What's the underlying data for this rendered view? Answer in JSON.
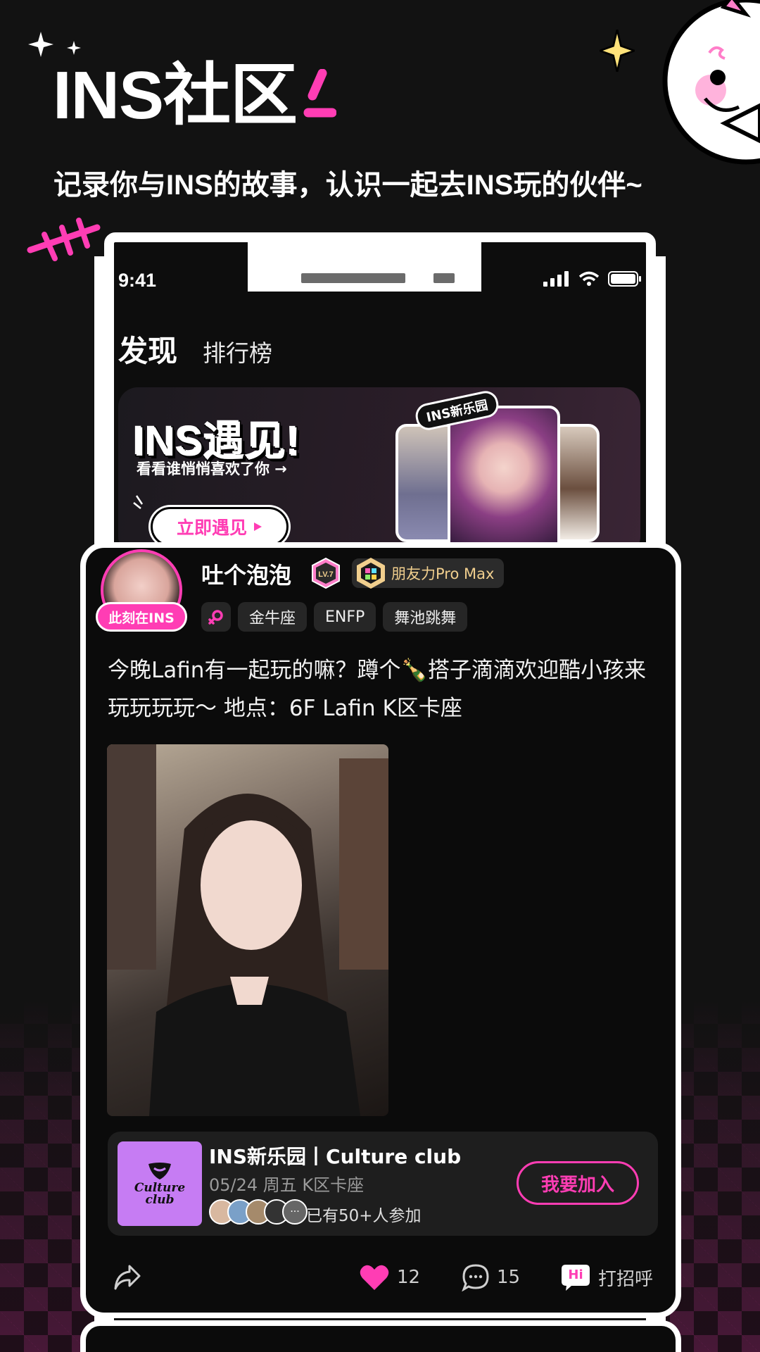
{
  "hero": {
    "title": "INS社区",
    "subtitle": "记录你与INS的故事，认识一起去INS玩的伙伴~"
  },
  "status_bar": {
    "time": "9:41"
  },
  "tabs": [
    {
      "label": "发现",
      "active": true
    },
    {
      "label": "排行榜",
      "active": false
    }
  ],
  "banner": {
    "title": "INS遇见!",
    "subtitle": "看看谁悄悄喜欢了你 →",
    "button_label": "立即遇见",
    "tag": "INS新乐园"
  },
  "post": {
    "author": "吐个泡泡",
    "now_badge": "此刻在INS",
    "level": "LV.7",
    "power_badge": "朋友力Pro Max",
    "tags": [
      "金牛座",
      "ENFP",
      "舞池跳舞"
    ],
    "text": "今晚Lafin有一起玩的嘛？蹲个🍾搭子滴滴欢迎酷小孩来玩玩玩玩～ 地点：6F Lafin K区卡座",
    "event": {
      "logo_line1": "Culture",
      "logo_line2": "club",
      "title": "INS新乐园丨Culture club",
      "date": "05/24 周五 K区卡座",
      "participants": "已有50+人参加",
      "join_label": "我要加入"
    },
    "actions": {
      "likes": "12",
      "comments": "15",
      "greet_label": "打招呼",
      "greet_badge": "Hi"
    }
  },
  "colors": {
    "accent": "#ff3db4",
    "background": "#121212",
    "gold": "#f1cf8e",
    "event_logo": "#c67cf3"
  }
}
